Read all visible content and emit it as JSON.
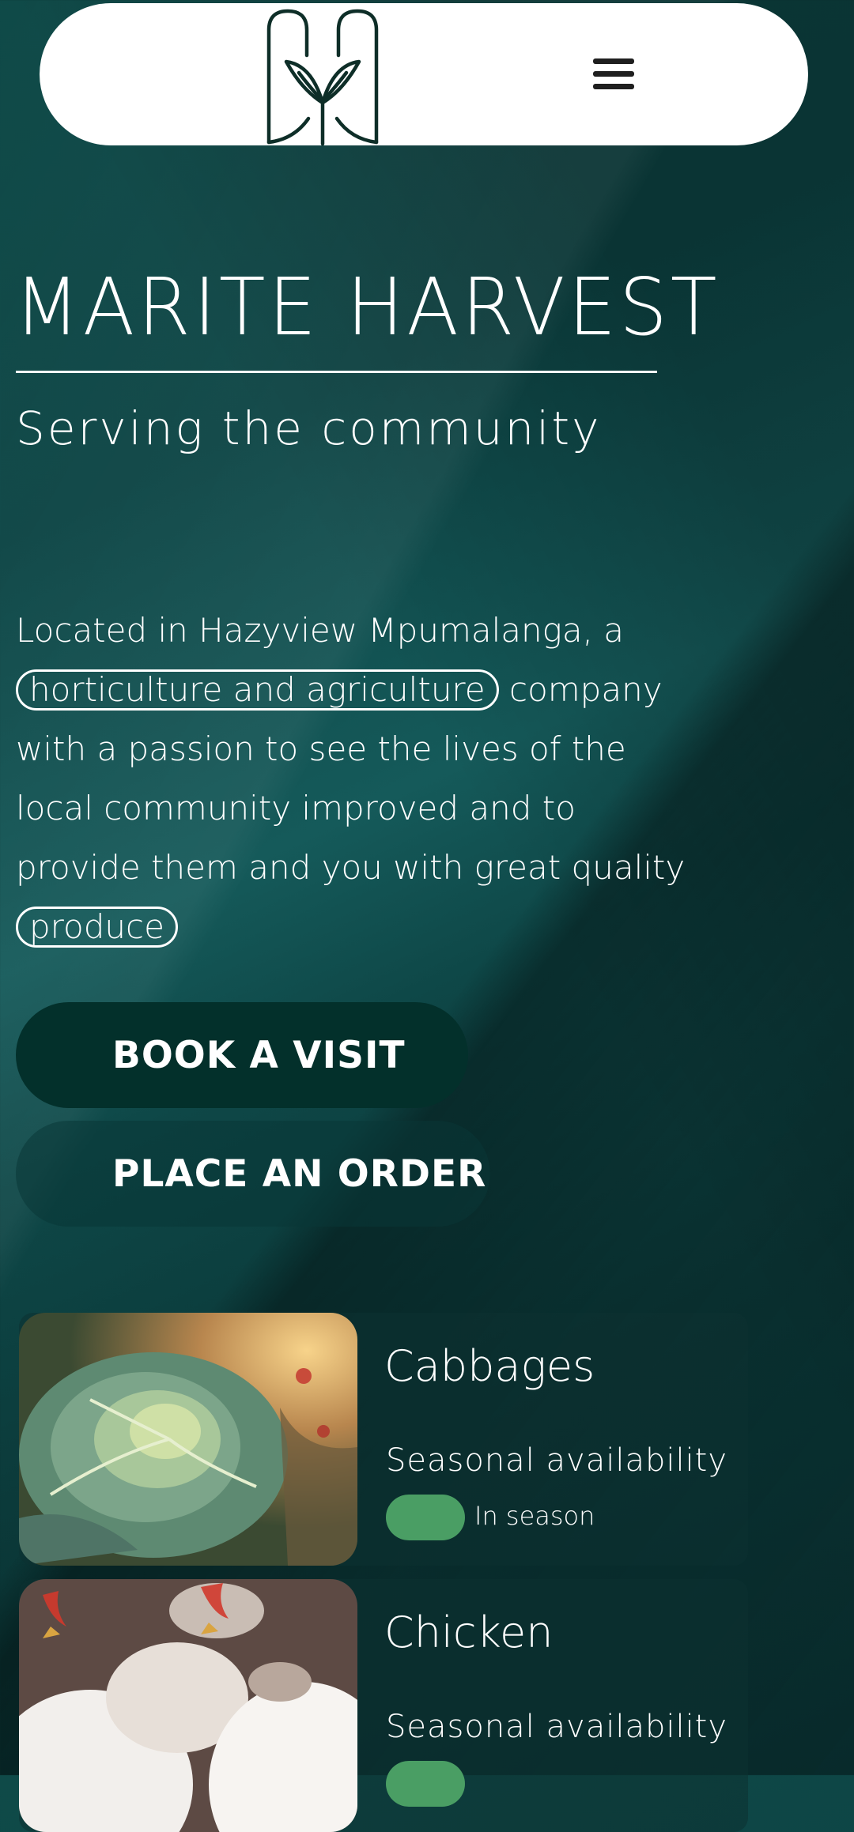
{
  "header": {
    "logo_icon": "leaf-monogram-logo",
    "menu_icon": "hamburger-menu-icon"
  },
  "hero": {
    "title": "MARITE HARVEST",
    "subtitle": "Serving the community",
    "intro_part1": "Located in Hazyview Mpumalanga, a ",
    "intro_highlight1": "horticulture and agriculture",
    "intro_part2": " company with a passion to see the lives of the local community improved and to provide them and you with great quality ",
    "intro_highlight2": "produce"
  },
  "actions": {
    "book_label": "BOOK A VISIT",
    "order_label": "PLACE AN ORDER"
  },
  "products": [
    {
      "name": "Cabbages",
      "availability_label": "Seasonal availability",
      "status": "In season",
      "status_color": "#4a9e64"
    },
    {
      "name": "Chicken",
      "availability_label": "Seasonal availability",
      "status": "",
      "status_color": "#4a9e64"
    }
  ],
  "colors": {
    "brand_dark": "#03302b",
    "logo_stroke": "#0e2e28",
    "accent_green": "#4a9e64"
  }
}
